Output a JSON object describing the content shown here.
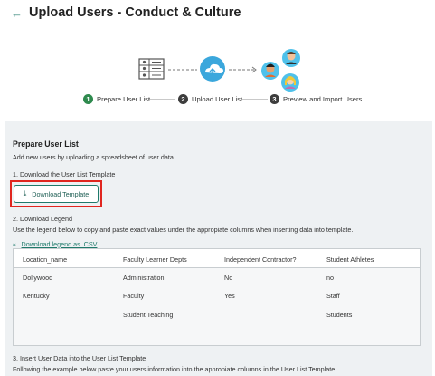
{
  "header": {
    "back_icon": "arrow-left-icon",
    "title": "Upload Users - Conduct & Culture"
  },
  "colors": {
    "accent": "#1f7a6b",
    "step_active": "#2e8a4e",
    "step_inactive": "#3d3d3d",
    "highlight_outline": "#e0261f",
    "panel_bg": "#eef1f3"
  },
  "steps": [
    {
      "number": "1",
      "label": "Prepare User List",
      "active": true
    },
    {
      "number": "2",
      "label": "Upload User List",
      "active": false
    },
    {
      "number": "3",
      "label": "Preview and Import Users",
      "active": false
    }
  ],
  "prepare": {
    "title": "Prepare User List",
    "subtitle": "Add new users by uploading a spreadsheet of user data.",
    "step1": "1. Download the User List Template",
    "download_template_icon": "download-icon",
    "download_template_label": "Download Template",
    "step2": "2. Download Legend",
    "legend_desc": "Use the legend below to copy and paste exact values under the appropiate columns when inserting data into template.",
    "legend_link_icon": "download-icon",
    "legend_link": "Download legend as .CSV",
    "step3": "3. Insert User Data into the User List Template",
    "step3_desc": "Following the example below paste your users information into the appropiate columns in the User List Template."
  },
  "legend_table": {
    "columns": [
      "Location_name",
      "Faculty Learner Depts",
      "Independent Contractor?",
      "Student Athletes"
    ],
    "rows": [
      [
        "Dollywood",
        "Administration",
        "No",
        "no"
      ],
      [
        "Kentucky",
        "Faculty",
        "Yes",
        "Staff"
      ],
      [
        "",
        "Student Teaching",
        "",
        "Students"
      ]
    ]
  }
}
